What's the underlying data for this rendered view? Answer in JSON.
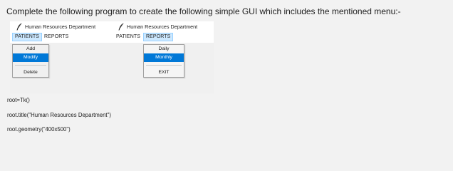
{
  "question": "Complete the following program to create the following simple GUI which includes the mentioned menu:-",
  "windows": [
    {
      "title": "Human Resources Department",
      "menus": [
        "PATIENTS",
        "REPORTS"
      ],
      "open_menu": "PATIENTS",
      "dropdown": {
        "items": [
          "Add",
          "Modify",
          "Delete"
        ],
        "selected": "Modify"
      }
    },
    {
      "title": "Human Resources Department",
      "menus": [
        "PATIENTS",
        "REPORTS"
      ],
      "open_menu": "REPORTS",
      "dropdown": {
        "items": [
          "Daily",
          "Monthly",
          "EXIT"
        ],
        "selected": "Monthly"
      }
    }
  ],
  "code": [
    "root=Tk()",
    "root.title(\"Human Resources Department\")",
    "root.geometry(\"400x500\")"
  ],
  "colors": {
    "highlight": "#0078d7",
    "menu_active_bg": "#cce8ff",
    "window_bg": "#f0f0f0"
  }
}
